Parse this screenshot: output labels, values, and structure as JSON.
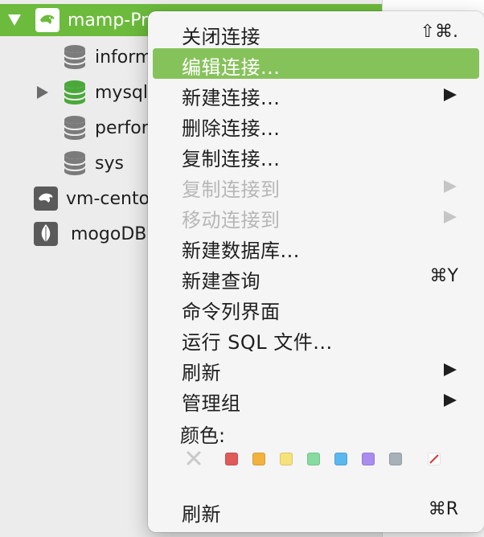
{
  "sidebar": {
    "connection": {
      "label": "mamp-Pr"
    },
    "databases": [
      {
        "label": "inform"
      },
      {
        "label": "mysql"
      },
      {
        "label": "perfor"
      },
      {
        "label": "sys"
      }
    ],
    "other_connections": [
      {
        "label": "vm-cento"
      },
      {
        "label": "mogoDB"
      }
    ]
  },
  "context_menu": {
    "items": [
      {
        "label": "关闭连接",
        "shortcut": "⇧⌘."
      },
      {
        "label": "编辑连接..."
      },
      {
        "label": "新建连接..."
      },
      {
        "label": "删除连接..."
      },
      {
        "label": "复制连接..."
      },
      {
        "label": "复制连接到"
      },
      {
        "label": "移动连接到"
      },
      {
        "label": "新建数据库..."
      },
      {
        "label": "新建查询",
        "shortcut": "⌘Y"
      },
      {
        "label": "命令列界面"
      },
      {
        "label": "运行 SQL 文件..."
      },
      {
        "label": "刷新"
      },
      {
        "label": "管理组"
      },
      {
        "label": "颜色:"
      },
      {
        "label": "刷新",
        "shortcut": "⌘R"
      }
    ],
    "colors": [
      "#e05a5a",
      "#f2b33d",
      "#f6e27a",
      "#86dc9f",
      "#5ab8ef",
      "#a98cee",
      "#a8b0b8"
    ]
  },
  "theme": {
    "accent": "#6cbb3c",
    "highlight": "#86c25a"
  }
}
